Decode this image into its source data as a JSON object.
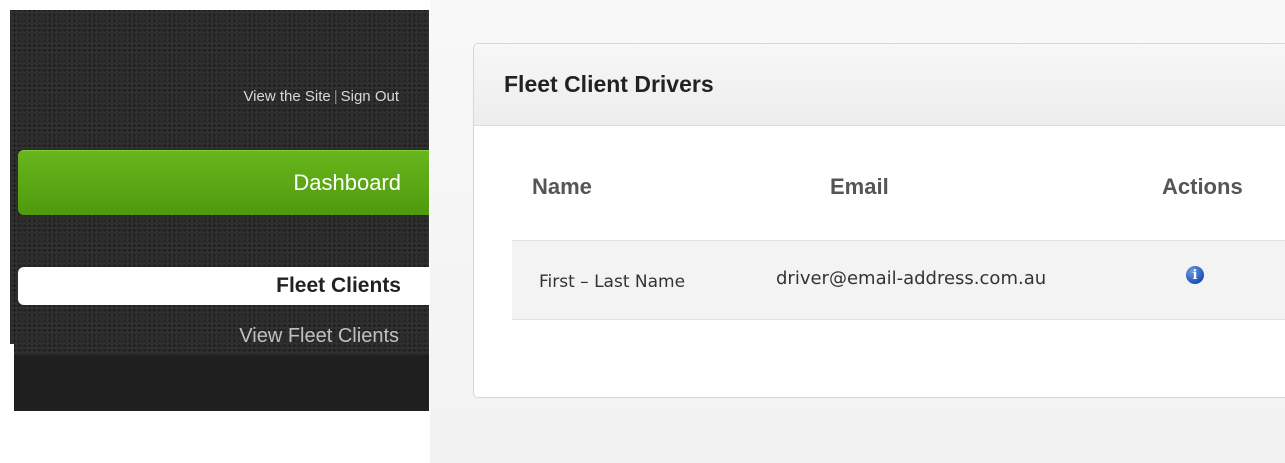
{
  "sidebar": {
    "top_links": {
      "view_site": "View the Site",
      "separator": "|",
      "sign_out": "Sign Out"
    },
    "nav": {
      "dashboard": "Dashboard",
      "fleet_clients": "Fleet Clients",
      "view_fleet_clients": "View Fleet Clients"
    }
  },
  "panel": {
    "title": "Fleet Client Drivers",
    "table": {
      "columns": [
        "Name",
        "Email",
        "Actions"
      ],
      "rows": [
        {
          "name": "First – Last Name",
          "email": "driver@email-address.com.au",
          "action_icon": "info-icon"
        }
      ]
    }
  },
  "colors": {
    "sidebar_bg": "#2b2b2b",
    "dashboard_green": "#5aa814",
    "info_blue": "#2a5dc0"
  }
}
